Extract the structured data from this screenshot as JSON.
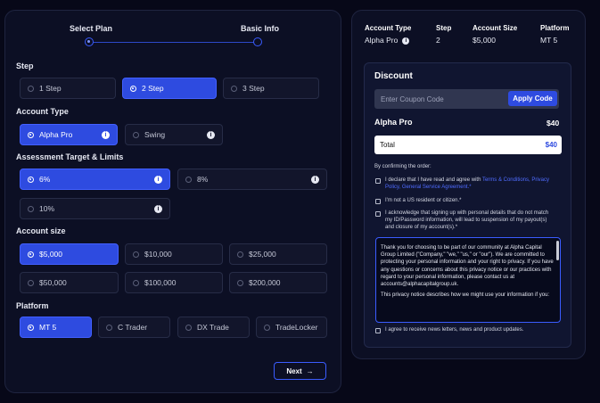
{
  "stepper": {
    "step1_label": "Select Plan",
    "step2_label": "Basic Info"
  },
  "sections": {
    "step": "Step",
    "account_type": "Account Type",
    "assessment": "Assessment Target & Limits",
    "account_size": "Account size",
    "platform": "Platform"
  },
  "step_options": [
    {
      "label": "1 Step",
      "selected": false
    },
    {
      "label": "2 Step",
      "selected": true
    },
    {
      "label": "3 Step",
      "selected": false
    }
  ],
  "account_types": [
    {
      "label": "Alpha Pro",
      "selected": true
    },
    {
      "label": "Swing",
      "selected": false
    }
  ],
  "targets": [
    {
      "label": "6%",
      "selected": true
    },
    {
      "label": "8%",
      "selected": false
    },
    {
      "label": "10%",
      "selected": false
    }
  ],
  "sizes": [
    {
      "label": "$5,000",
      "selected": true
    },
    {
      "label": "$10,000",
      "selected": false
    },
    {
      "label": "$25,000",
      "selected": false
    },
    {
      "label": "$50,000",
      "selected": false
    },
    {
      "label": "$100,000",
      "selected": false
    },
    {
      "label": "$200,000",
      "selected": false
    }
  ],
  "platforms": [
    {
      "label": "MT 5",
      "selected": true
    },
    {
      "label": "C Trader",
      "selected": false
    },
    {
      "label": "DX Trade",
      "selected": false
    },
    {
      "label": "TradeLocker",
      "selected": false
    }
  ],
  "next_button": {
    "label": "Next",
    "arrow": "→"
  },
  "info_glyph": "i",
  "summary": {
    "headers": [
      "Account Type",
      "Step",
      "Account Size",
      "Platform"
    ],
    "values": [
      "Alpha Pro",
      "2",
      "$5,000",
      "MT 5"
    ]
  },
  "discount": {
    "title": "Discount",
    "placeholder": "Enter Coupon Code",
    "apply_label": "Apply Code"
  },
  "order": {
    "plan_name": "Alpha Pro",
    "plan_price": "$40",
    "total_label": "Total",
    "total_value": "$40"
  },
  "confirm": {
    "intro": "By confirming the order:",
    "decl1_text": "I declare that I have read and agree with ",
    "decl1_link": "Terms & Conditions, Privacy Policy, General Service Agreement.*",
    "decl2": "I'm not a US resident or citizen.*",
    "decl3": "I acknowledge that signing up with personal details that do not match my ID/Password information, will lead to suspension of my payout(s) and closure of my account(s).*",
    "newsletter": "I agree to receive news letters, news and product updates."
  },
  "terms_text": {
    "p1": "Thank you for choosing to be part of our community at Alpha Capital Group Limited (\"Company,\" \"we,\" \"us,\" or \"our\"). We are committed to protecting your personal information and your right to privacy. If you have any questions or concerns about this privacy notice or our practices with regard to your personal information, please contact us at accounts@alphacapitalgroup.uk.",
    "p2": "This privacy notice describes how we might use your information if you:"
  },
  "colors": {
    "accent": "#2e4be0",
    "background": "#070818",
    "panel": "#0c0f24",
    "link": "#4f6cff"
  }
}
